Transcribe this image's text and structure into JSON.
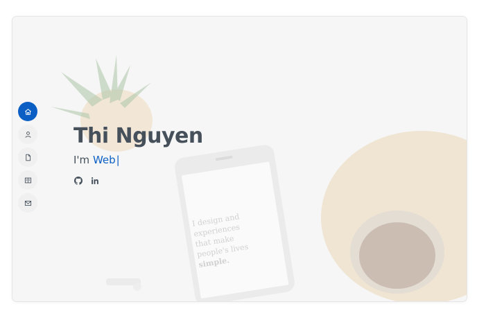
{
  "hero": {
    "name": "Thi Nguyen",
    "typed_prefix": "I'm",
    "typed_word": "Web",
    "cursor": "|"
  },
  "nav": {
    "items": [
      {
        "id": "home",
        "icon": "home-icon",
        "active": true
      },
      {
        "id": "about",
        "icon": "person-icon",
        "active": false
      },
      {
        "id": "resume",
        "icon": "file-icon",
        "active": false
      },
      {
        "id": "portfolio",
        "icon": "book-icon",
        "active": false
      },
      {
        "id": "contact",
        "icon": "envelope-icon",
        "active": false
      }
    ]
  },
  "social": {
    "items": [
      {
        "id": "github",
        "icon": "github-icon"
      },
      {
        "id": "linkedin",
        "icon": "linkedin-icon"
      }
    ]
  },
  "background": {
    "phone_text_1": "I design and",
    "phone_text_2": "experiences",
    "phone_text_3": "that make",
    "phone_text_4": "people's lives",
    "phone_text_5": "simple."
  },
  "colors": {
    "accent": "#0b5fc4",
    "text": "#45505b",
    "nav_bg": "#f0f0f0"
  }
}
